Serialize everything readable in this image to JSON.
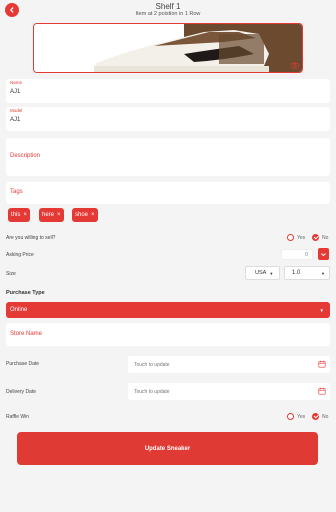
{
  "header": {
    "title": "Shelf 1",
    "subtitle": "Item at 2 poistion in 1 Row"
  },
  "fields": {
    "name": {
      "label": "Name",
      "value": "AJ1"
    },
    "model": {
      "label": "Model",
      "value": "AJ1"
    },
    "description": {
      "placeholder": "Description"
    },
    "tags": {
      "placeholder": "Tags"
    }
  },
  "chips": [
    "this",
    "here",
    "shoe"
  ],
  "sell": {
    "label": "Are you willing to sell?",
    "yes": "Yes",
    "no": "No",
    "selected": "No"
  },
  "asking": {
    "label": "Asking Price",
    "value": "0"
  },
  "size": {
    "label": "Size",
    "region": "USA",
    "value": "1.0"
  },
  "purchase": {
    "section": "Purchase Type",
    "selected": "Online",
    "store_placeholder": "Store Name"
  },
  "purchase_date": {
    "label": "Purchase Date",
    "placeholder": "Touch to update"
  },
  "delivery_date": {
    "label": "Delivery Date",
    "placeholder": "Touch to update"
  },
  "raffle": {
    "label": "Raffle Win",
    "yes": "Yes",
    "no": "No",
    "selected": "No"
  },
  "actions": {
    "update": "Update Sneaker"
  },
  "colors": {
    "accent": "#e53935",
    "background": "#f4f4f4"
  }
}
